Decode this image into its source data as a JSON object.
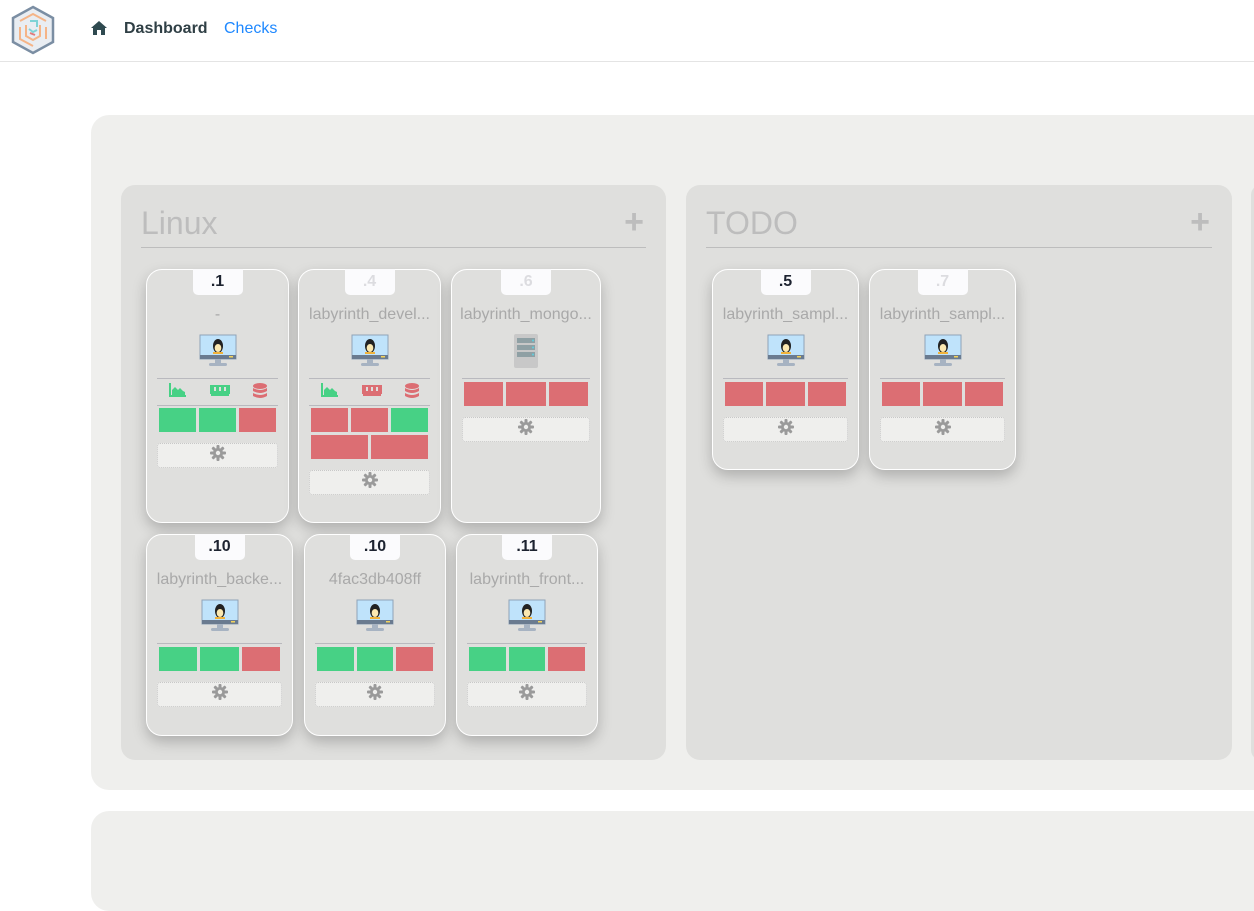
{
  "nav": {
    "dashboard": "Dashboard",
    "checks": "Checks"
  },
  "colors": {
    "ok": "#47d185",
    "fail": "#dc6e73",
    "accent": "#1e88ff"
  },
  "groups": [
    {
      "title": "Linux",
      "add": "+",
      "cards": [
        {
          "ip": ".1",
          "faded": false,
          "name": "-",
          "os": "linux-monitor-icon",
          "metrics": [
            "ok",
            "ok",
            "fail"
          ],
          "bars": [
            "ok",
            "ok",
            "fail"
          ]
        },
        {
          "ip": ".4",
          "faded": true,
          "name": "labyrinth_devel...",
          "os": "linux-monitor-icon",
          "metrics": [
            "ok",
            "fail",
            "fail"
          ],
          "bars": [
            "fail",
            "fail",
            "ok",
            "fail",
            "fail"
          ]
        },
        {
          "ip": ".6",
          "faded": true,
          "name": "labyrinth_mongo...",
          "os": "server-icon",
          "metrics": [],
          "bars": [
            "fail",
            "fail",
            "fail"
          ]
        },
        {
          "ip": ".10",
          "faded": false,
          "name": "labyrinth_backe...",
          "os": "linux-monitor-icon",
          "metrics": [],
          "bars": [
            "ok",
            "ok",
            "fail"
          ]
        },
        {
          "ip": ".10",
          "faded": false,
          "name": "4fac3db408ff",
          "os": "linux-monitor-icon",
          "metrics": [],
          "bars": [
            "ok",
            "ok",
            "fail"
          ]
        },
        {
          "ip": ".11",
          "faded": false,
          "name": "labyrinth_front...",
          "os": "linux-monitor-icon",
          "metrics": [],
          "bars": [
            "ok",
            "ok",
            "fail"
          ]
        }
      ]
    },
    {
      "title": "TODO",
      "add": "+",
      "cards": [
        {
          "ip": ".5",
          "faded": false,
          "name": "labyrinth_sampl...",
          "os": "linux-monitor-icon",
          "metrics": [],
          "bars": [
            "fail",
            "fail",
            "fail"
          ]
        },
        {
          "ip": ".7",
          "faded": true,
          "name": "labyrinth_sampl...",
          "os": "linux-monitor-icon",
          "metrics": [],
          "bars": [
            "fail",
            "fail",
            "fail"
          ]
        }
      ]
    }
  ]
}
